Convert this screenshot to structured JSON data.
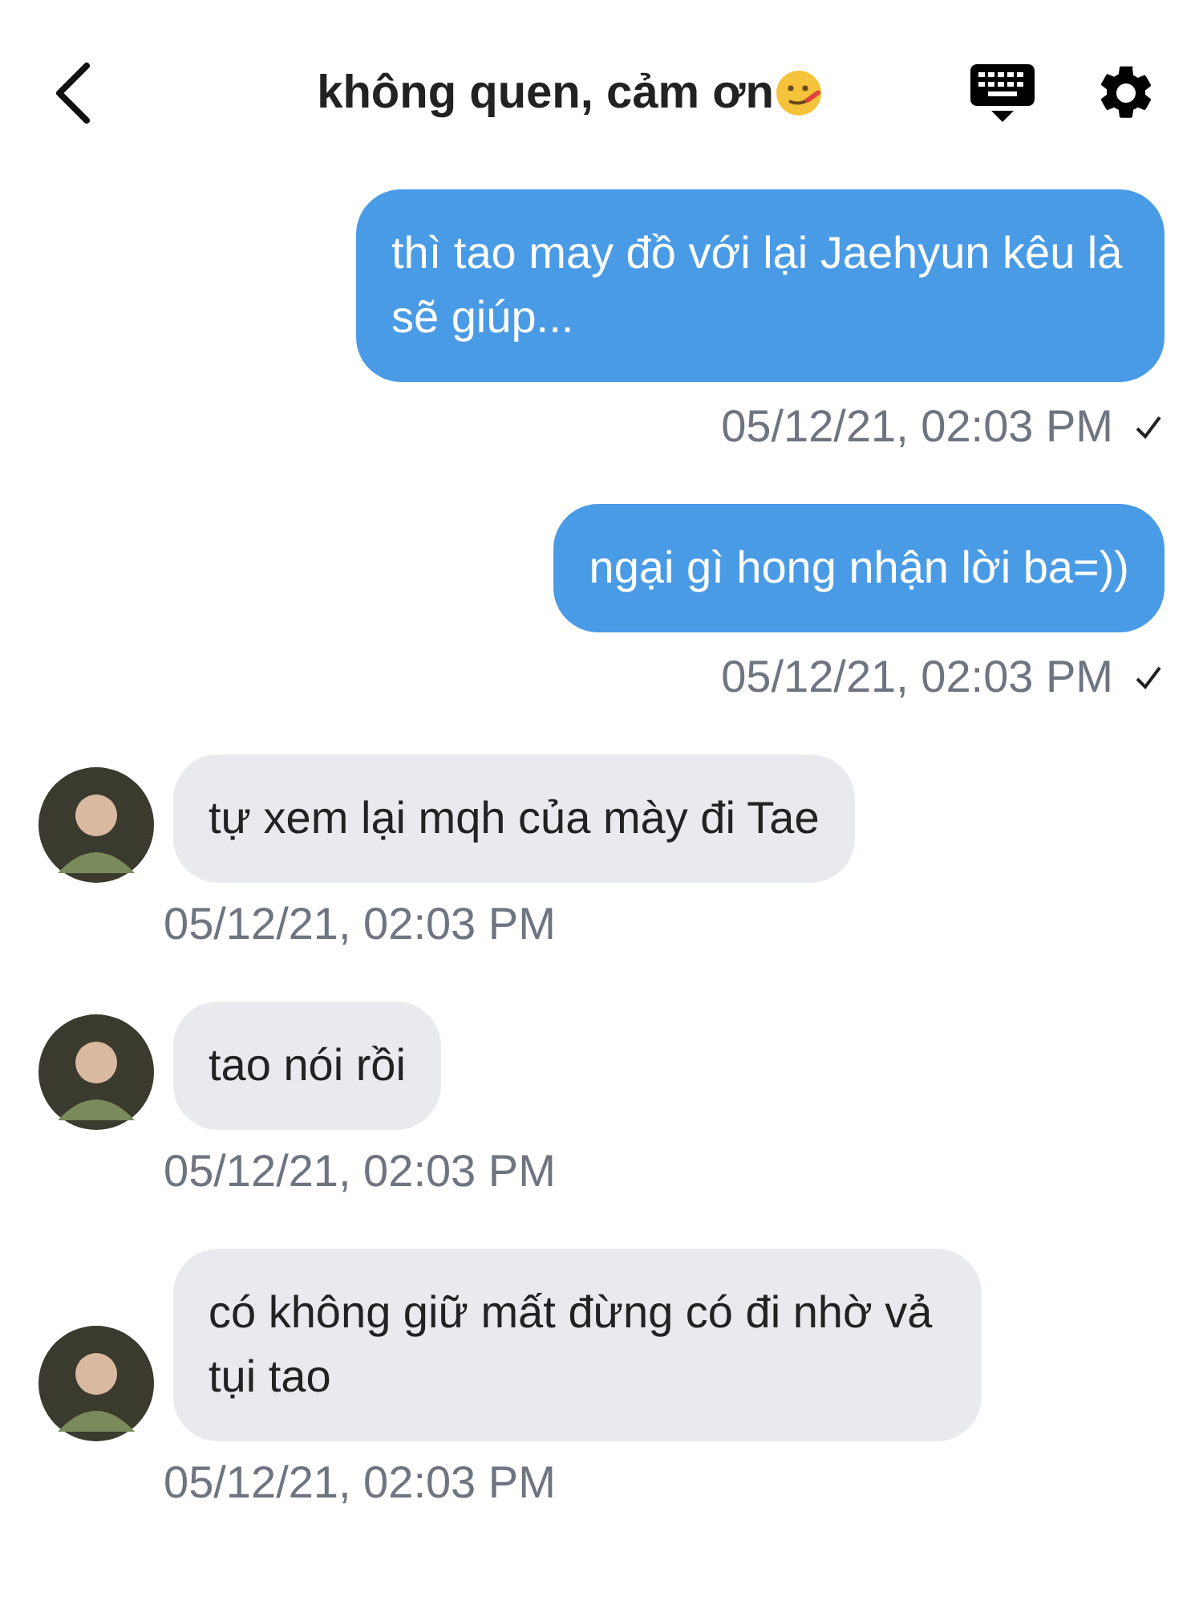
{
  "header": {
    "title": "không quen, cảm ơn"
  },
  "messages": [
    {
      "kind": "sent",
      "text": "thì tao may đồ với lại Jaehyun kêu là sẽ giúp...",
      "time": "05/12/21, 02:03 PM",
      "checked": true
    },
    {
      "kind": "sent",
      "text": "ngại gì hong nhận lời ba=))",
      "time": "05/12/21, 02:03 PM",
      "checked": true
    },
    {
      "kind": "received",
      "text": "tự xem lại mqh của mày đi Tae",
      "time": "05/12/21, 02:03 PM"
    },
    {
      "kind": "received",
      "text": "tao nói rồi",
      "time": "05/12/21, 02:03 PM"
    },
    {
      "kind": "received",
      "text": "có không giữ mất đừng có đi nhờ vả tụi tao",
      "time": "05/12/21, 02:03 PM"
    }
  ]
}
